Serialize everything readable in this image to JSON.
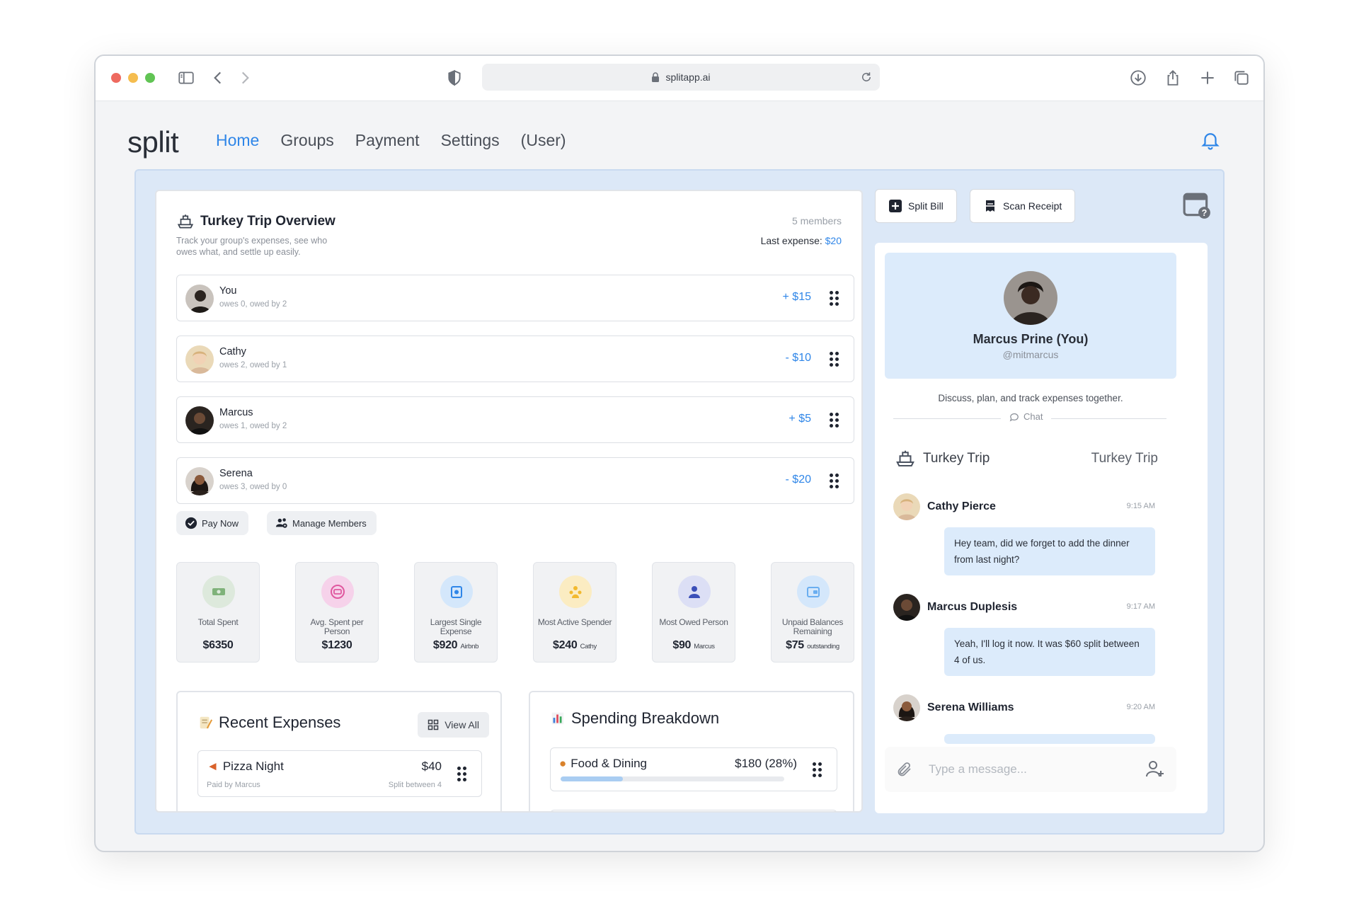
{
  "browser": {
    "url": "splitapp.ai"
  },
  "app": {
    "logo": "split",
    "nav": [
      "Home",
      "Groups",
      "Payment",
      "Settings",
      "(User)"
    ],
    "active_nav": "Home"
  },
  "overview": {
    "title": "Turkey Trip Overview",
    "subtitle": "Track your group's expenses, see who owes what, and settle up easily.",
    "members_count": "5 members",
    "last_expense_label": "Last expense:",
    "last_expense_value": "$20",
    "members": [
      {
        "name": "You",
        "sub": "owes 0, owed by 2",
        "amount": "+ $15"
      },
      {
        "name": "Cathy",
        "sub": "owes 2, owed by 1",
        "amount": "- $10"
      },
      {
        "name": "Marcus",
        "sub": "owes 1, owed by 2",
        "amount": "+ $5"
      },
      {
        "name": "Serena",
        "sub": "owes 3, owed by 0",
        "amount": "- $20"
      }
    ],
    "pay_now": "Pay Now",
    "manage_members": "Manage Members"
  },
  "stats": [
    {
      "label": "Total Spent",
      "value": "$6350",
      "note": ""
    },
    {
      "label": "Avg. Spent per Person",
      "value": "$1230",
      "note": ""
    },
    {
      "label": "Largest Single Expense",
      "value": "$920",
      "note": "Airbnb"
    },
    {
      "label": "Most Active Spender",
      "value": "$240",
      "note": "Cathy"
    },
    {
      "label": "Most Owed Person",
      "value": "$90",
      "note": "Marcus"
    },
    {
      "label": "Unpaid Balances Remaining",
      "value": "$75",
      "note": "outstanding"
    }
  ],
  "recent_expenses": {
    "title": "Recent Expenses",
    "view_all": "View All",
    "items": [
      {
        "title": "Pizza Night",
        "paid_by": "Paid by Marcus",
        "amount": "$40",
        "split": "Split between 4"
      }
    ]
  },
  "spending_breakdown": {
    "title": "Spending Breakdown",
    "items": [
      {
        "title": "Food & Dining",
        "amount": "$180 (28%)",
        "progress": 0.28
      }
    ]
  },
  "actions": {
    "split_bill": "Split Bill",
    "scan_receipt": "Scan Receipt"
  },
  "profile": {
    "name": "Marcus Prine (You)",
    "handle": "@mitmarcus"
  },
  "chat": {
    "intro": "Discuss, plan, and track expenses together.",
    "label": "Chat",
    "group_name": "Turkey Trip",
    "group_name_right": "Turkey Trip",
    "messages": [
      {
        "author": "Cathy Pierce",
        "time": "9:15 AM",
        "text": "Hey team, did we forget to add the dinner from last night?"
      },
      {
        "author": "Marcus Duplesis",
        "time": "9:17 AM",
        "text": "Yeah, I'll log it now. It was $60 split between 4 of us."
      },
      {
        "author": "Serena Williams",
        "time": "9:20 AM",
        "text": ""
      }
    ],
    "placeholder": "Type a message..."
  }
}
